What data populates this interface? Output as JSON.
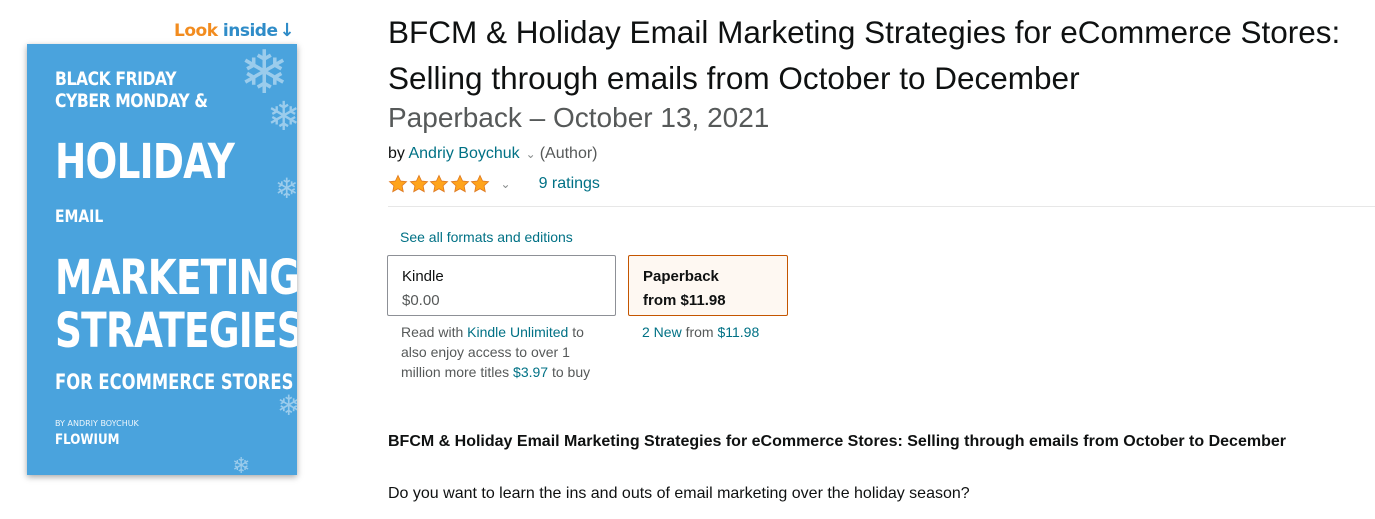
{
  "look_inside": {
    "word1": "Look",
    "word2": "inside",
    "arrow": "↓"
  },
  "cover": {
    "lines": [
      "BLACK FRIDAY",
      "CYBER MONDAY &",
      "HOLIDAY",
      "EMAIL",
      "MARKETING",
      "STRATEGIES",
      "FOR ECOMMERCE STORES",
      "BY ANDRIY BOYCHUK",
      "FLOWIUM"
    ],
    "background_color": "#4aa3dd"
  },
  "product": {
    "title": "BFCM & Holiday Email Marketing Strategies for eCommerce Stores: Selling through emails from October to December",
    "edition": "Paperback – October 13, 2021",
    "by_label": "by",
    "author": "Andriy Boychuk",
    "author_role": "(Author)",
    "rating_value": 5,
    "ratings_count": "9 ratings",
    "star_color": "#ffa41c"
  },
  "formats": {
    "see_all": "See all formats and editions",
    "kindle": {
      "label": "Kindle",
      "price": "$0.00"
    },
    "paperback": {
      "label": "Paperback",
      "price": "from $11.98"
    },
    "kindle_note": {
      "prefix": "Read with",
      "link": "Kindle Unlimited",
      "body": "to also enjoy access to over 1 million more titles",
      "buy_price": "$3.97",
      "buy_suffix": "to buy"
    },
    "paper_note": {
      "new_link": "2 New",
      "from_label": "from",
      "price": "$11.98"
    }
  },
  "description": {
    "title": "BFCM & Holiday Email Marketing Strategies for eCommerce Stores: Selling through emails from October to December",
    "first_line": "Do you want to learn the ins and outs of email marketing over the holiday season?"
  },
  "colors": {
    "link": "#007185",
    "selected_border": "#c45500",
    "selected_bg": "#fef8f2"
  }
}
